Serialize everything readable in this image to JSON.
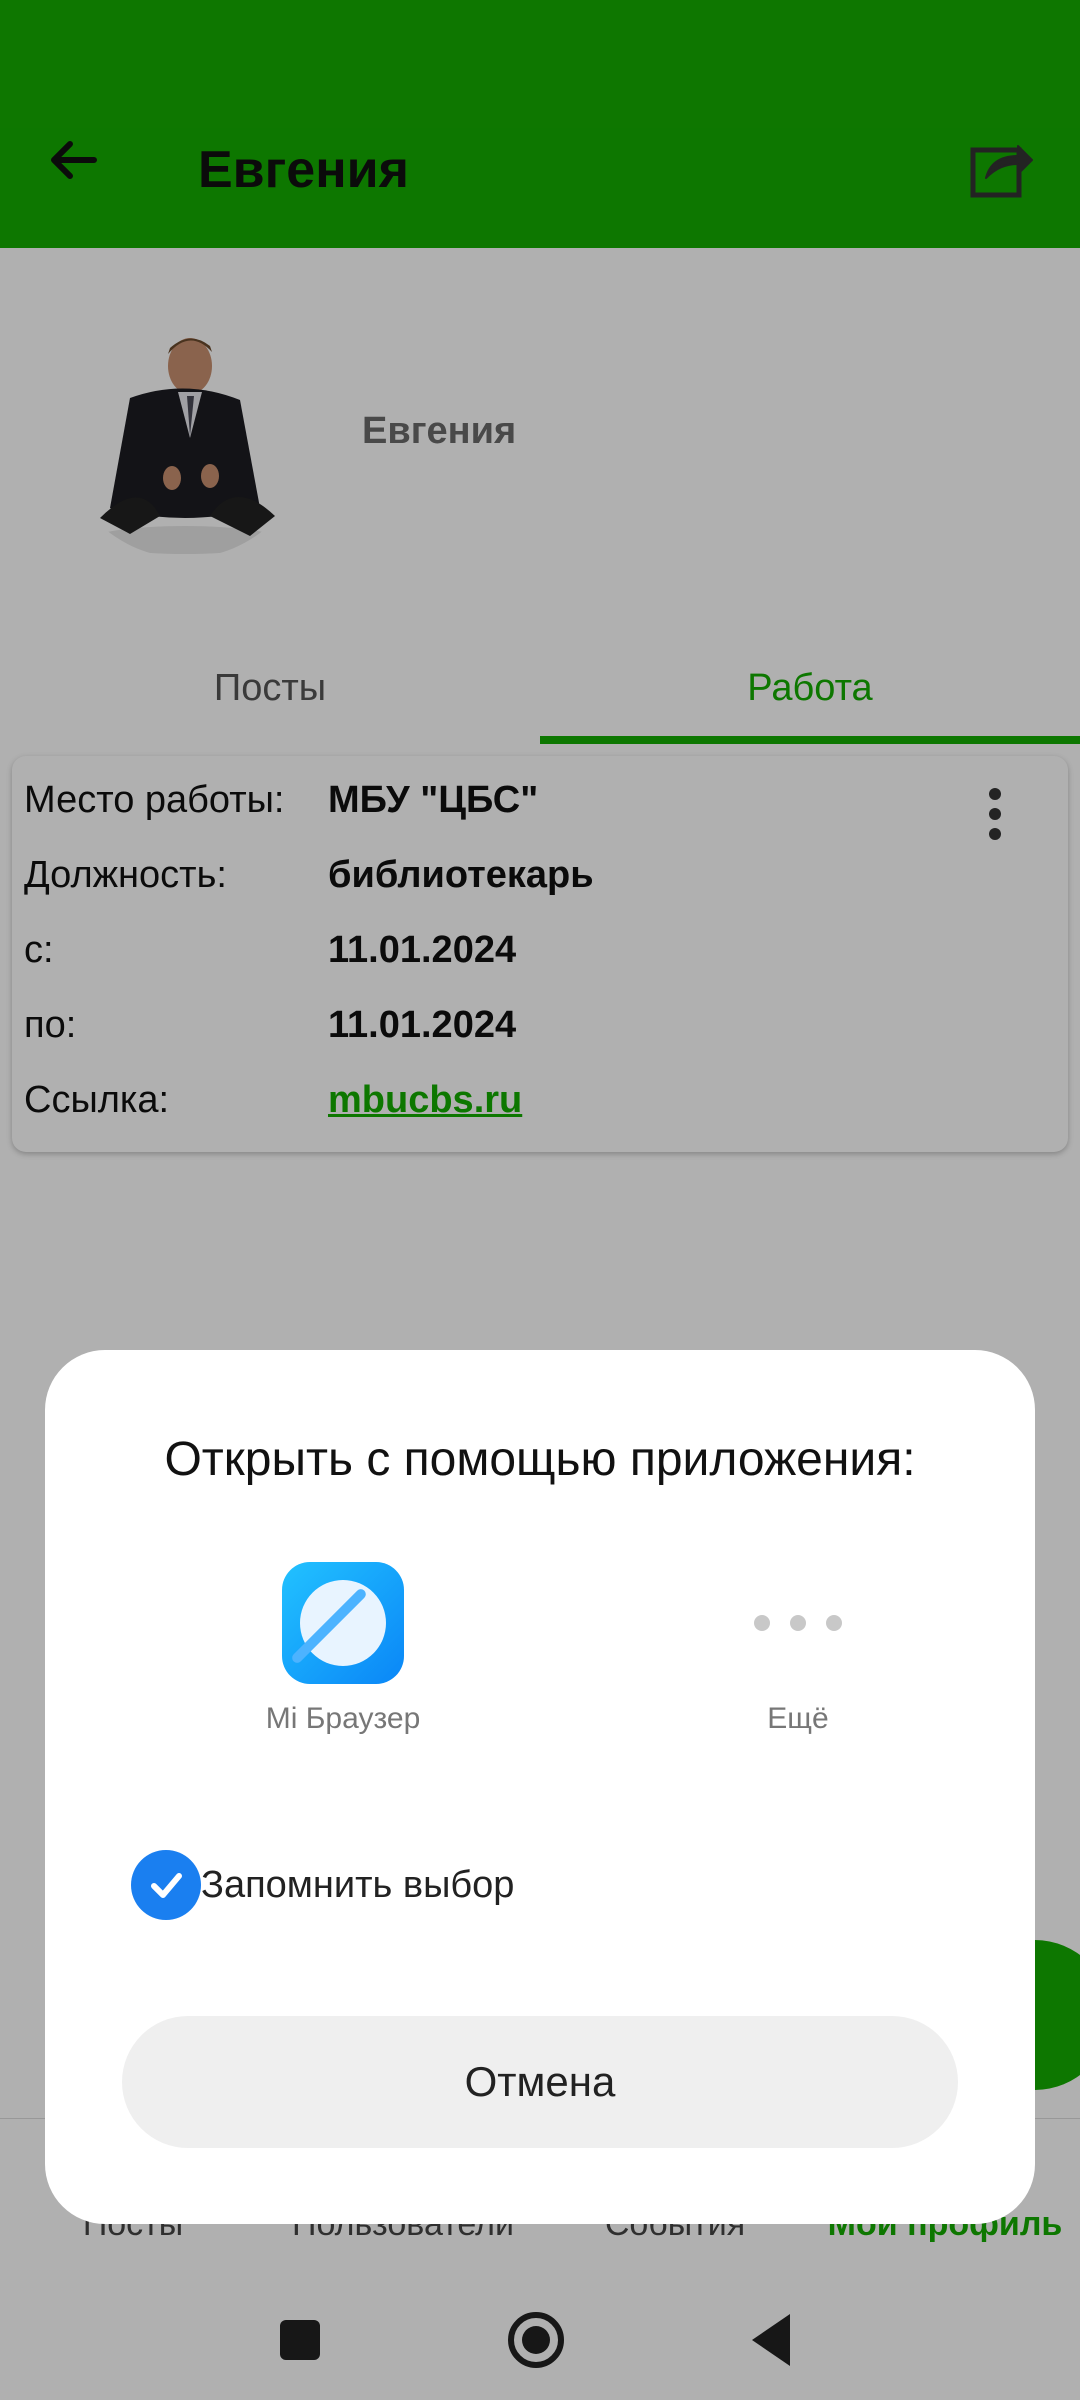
{
  "appbar": {
    "title": "Евгения",
    "back_icon": "arrow-left-icon",
    "share_icon": "share-icon"
  },
  "profile": {
    "name": "Евгения"
  },
  "tabs": [
    {
      "label": "Посты",
      "active": false
    },
    {
      "label": "Работа",
      "active": true
    }
  ],
  "work": {
    "rows": [
      {
        "label": "Место работы:",
        "value": "МБУ \"ЦБС\""
      },
      {
        "label": "Должность:",
        "value": "библиотекарь"
      },
      {
        "label": "с:",
        "value": "11.01.2024"
      },
      {
        "label": "по:",
        "value": "11.01.2024"
      },
      {
        "label": "Ссылка:",
        "value": "mbucbs.ru"
      }
    ]
  },
  "bottom_nav": [
    {
      "label": "Посты",
      "active": false
    },
    {
      "label": "Пользователи",
      "active": false
    },
    {
      "label": "События",
      "active": false
    },
    {
      "label": "Мой профиль",
      "active": true
    }
  ],
  "dialog": {
    "title": "Открыть с помощью приложения:",
    "apps": [
      {
        "label": "Mi Браузер",
        "icon": "mi-browser-icon"
      },
      {
        "label": "Ещё",
        "icon": "more-dots-icon"
      }
    ],
    "remember_label": "Запомнить выбор",
    "remember_checked": true,
    "cancel_label": "Отмена"
  },
  "colors": {
    "brand": "#14ad00",
    "check_blue": "#1a7ff0"
  }
}
